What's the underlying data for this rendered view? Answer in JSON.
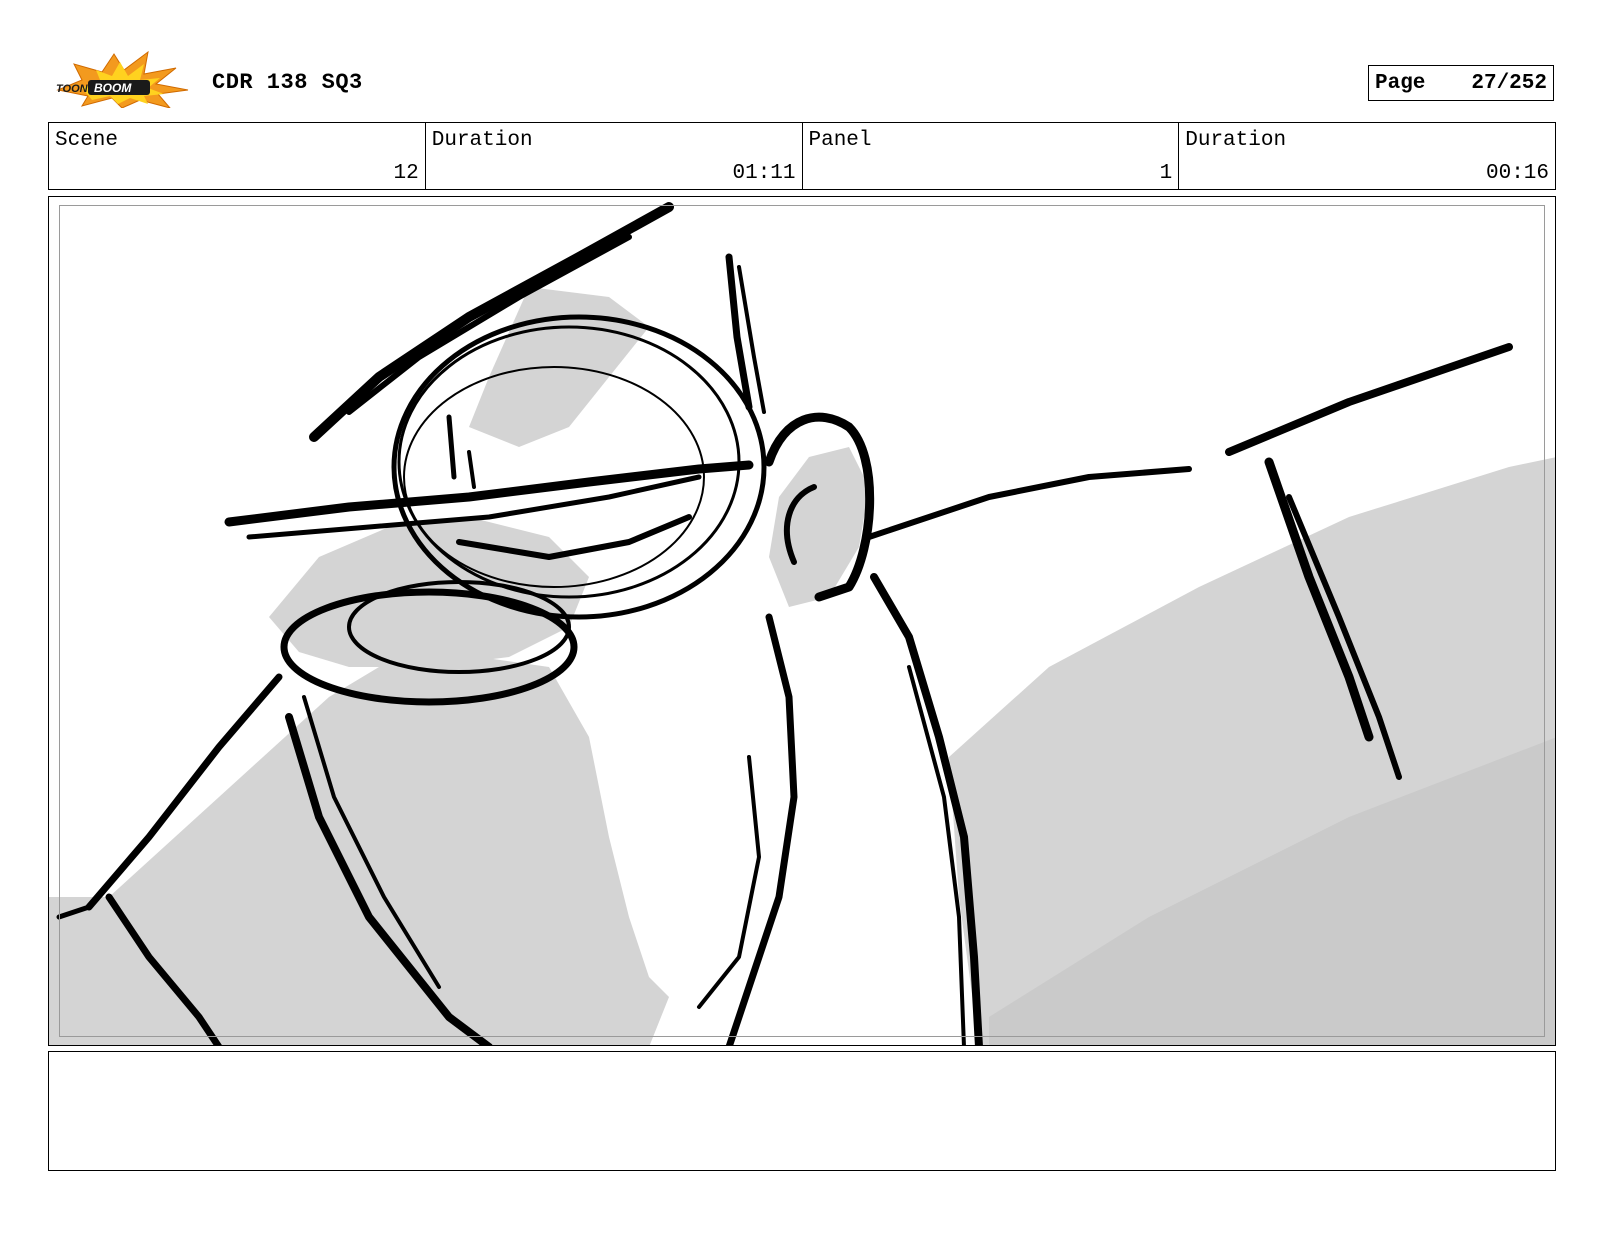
{
  "header": {
    "logo_text": "TOON BOOM",
    "project_title": "CDR 138 SQ3",
    "page_label": "Page",
    "page_number": "27/252"
  },
  "info": {
    "scene_label": "Scene",
    "scene_value": "12",
    "scene_duration_label": "Duration",
    "scene_duration_value": "01:11",
    "panel_label": "Panel",
    "panel_value": "1",
    "panel_duration_label": "Duration",
    "panel_duration_value": "00:16"
  },
  "panel": {
    "image": "storyboard-sketch-character-closeup"
  },
  "notes": {
    "text": ""
  },
  "colors": {
    "logo_orange": "#f39a1e",
    "logo_yellow": "#ffd21f",
    "sketch_gray": "#d4d4d4",
    "ink": "#000000"
  }
}
